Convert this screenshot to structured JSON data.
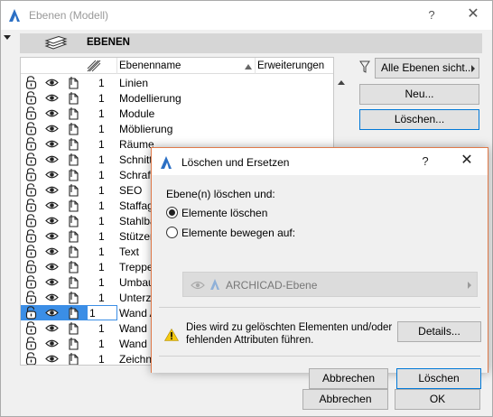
{
  "window": {
    "title": "Ebenen (Modell)",
    "help": "?",
    "close": "✕"
  },
  "section": {
    "title": "EBENEN"
  },
  "table": {
    "col_name": "Ebenenname",
    "col_ext": "Erweiterungen",
    "rows": [
      {
        "num": "1",
        "name": "Linien",
        "wire": "outline"
      },
      {
        "num": "1",
        "name": "Modellierung",
        "wire": "outline"
      },
      {
        "num": "1",
        "name": "Module",
        "wire": "outline"
      },
      {
        "num": "1",
        "name": "Möblierung",
        "wire": "outline"
      },
      {
        "num": "1",
        "name": "Räume",
        "wire": "outline"
      },
      {
        "num": "1",
        "name": "Schnitt",
        "wire": "outline"
      },
      {
        "num": "1",
        "name": "Schraff",
        "wire": "outline"
      },
      {
        "num": "1",
        "name": "SEO",
        "wire": "outline"
      },
      {
        "num": "1",
        "name": "Staffag",
        "wire": "outline"
      },
      {
        "num": "1",
        "name": "Stahlba",
        "wire": "outline"
      },
      {
        "num": "1",
        "name": "Stützen",
        "wire": "outline"
      },
      {
        "num": "1",
        "name": "Text",
        "wire": "outline"
      },
      {
        "num": "1",
        "name": "Treppe",
        "wire": "outline"
      },
      {
        "num": "1",
        "name": "Umbau",
        "wire": "outline"
      },
      {
        "num": "1",
        "name": "Unterz",
        "wire": "outline"
      },
      {
        "num": "1",
        "name": "Wand A",
        "wire": "outline"
      },
      {
        "num": "1",
        "name": "Wand I",
        "wire": "outline"
      },
      {
        "num": "1",
        "name": "Wand I",
        "wire": "outline"
      },
      {
        "num": "1",
        "name": "Zeichn",
        "wire": "outline"
      }
    ]
  },
  "filter": {
    "label": "Alle Ebenen sicht..."
  },
  "buttons": {
    "new": "Neu...",
    "delete": "Löschen...",
    "cancel": "Abbrechen",
    "ok": "OK"
  },
  "dialog": {
    "title": "Löschen und Ersetzen",
    "help": "?",
    "close": "✕",
    "prompt": "Ebene(n) löschen und:",
    "option_delete": "Elemente löschen",
    "option_move": "Elemente bewegen auf:",
    "selected_option": "delete",
    "target_layer": "ARCHICAD-Ebene",
    "warning": "Dies wird zu gelöschten Elementen und/oder fehlenden Attributen führen.",
    "details": "Details...",
    "cancel": "Abbrechen",
    "ok": "Löschen"
  },
  "colors": {
    "selection": "#3b8ee6",
    "dialog_border": "#e07a4a",
    "focus_border": "#0078d7",
    "warning_yellow": "#f2c811"
  }
}
